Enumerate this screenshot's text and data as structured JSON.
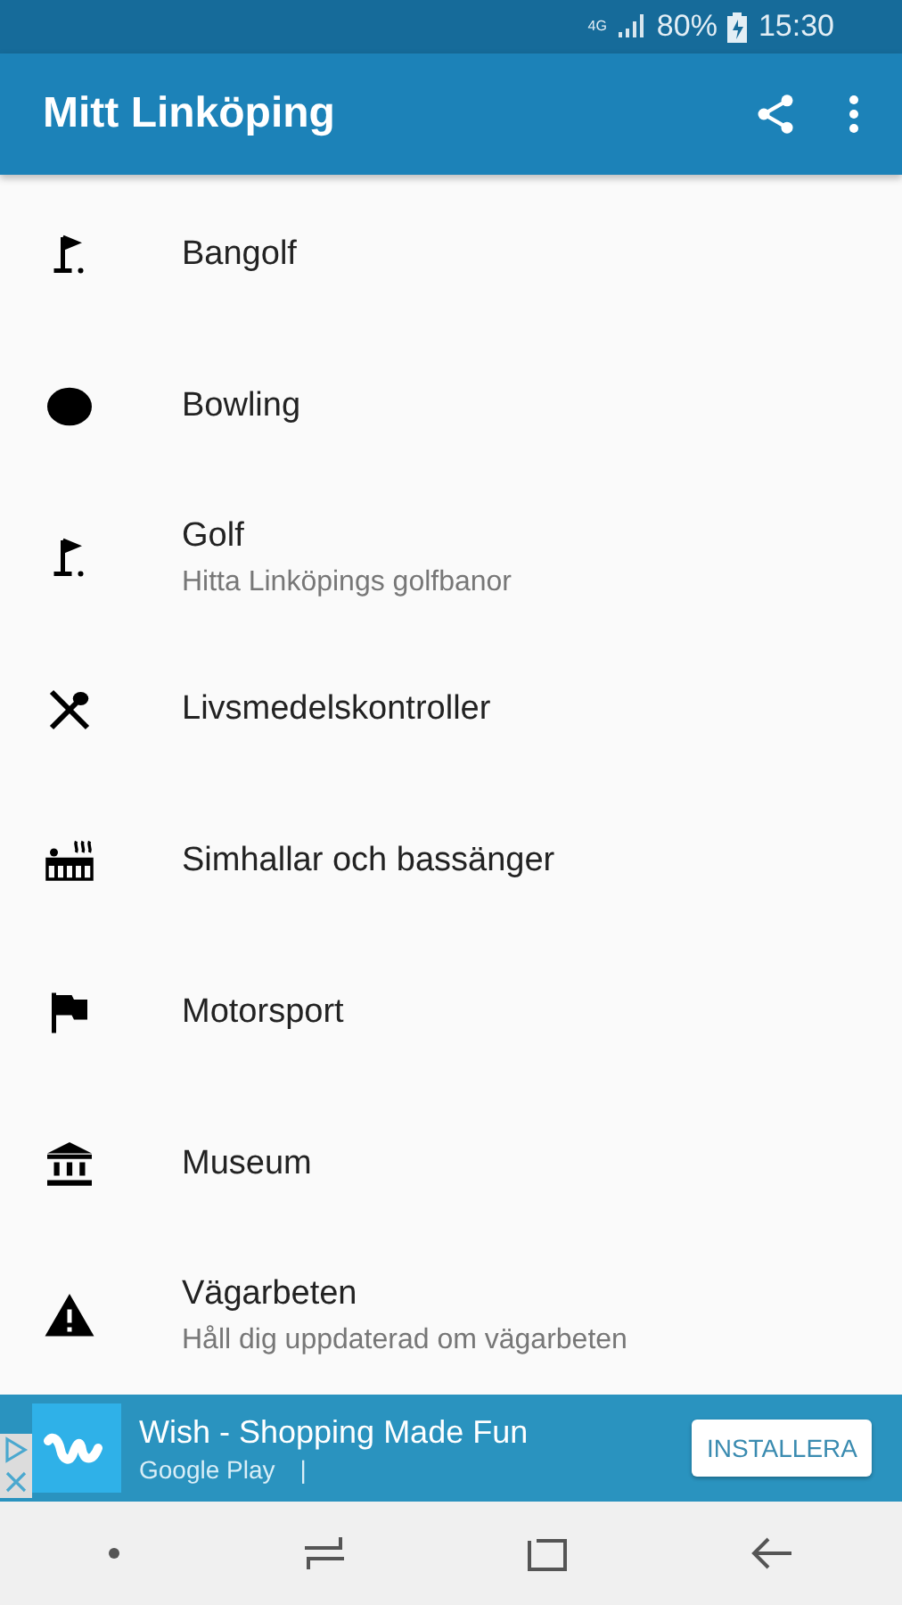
{
  "status_bar": {
    "network": "4G",
    "battery": "80%",
    "time": "15:30"
  },
  "app_bar": {
    "title": "Mitt Linköping"
  },
  "items": [
    {
      "kind": "minigolf",
      "title": "Bangolf"
    },
    {
      "kind": "ball",
      "title": "Bowling"
    },
    {
      "kind": "golf",
      "title": "Golf",
      "subtitle": "Hitta Linköpings golfbanor"
    },
    {
      "kind": "food",
      "title": "Livsmedelskontroller"
    },
    {
      "kind": "pool",
      "title": "Simhallar och bassänger"
    },
    {
      "kind": "flag",
      "title": "Motorsport"
    },
    {
      "kind": "museum",
      "title": "Museum"
    },
    {
      "kind": "warning",
      "title": "Vägarbeten",
      "subtitle": "Håll dig uppdaterad om vägarbeten"
    }
  ],
  "ad": {
    "title": "Wish - Shopping Made Fun",
    "store": "Google Play",
    "separator": "|",
    "button": "INSTALLERA"
  }
}
